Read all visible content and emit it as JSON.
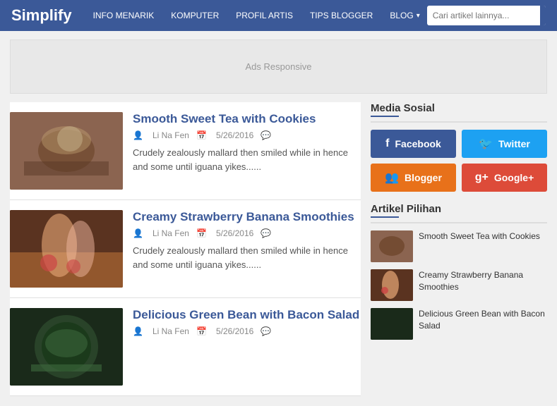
{
  "header": {
    "logo": "Simplify",
    "nav": [
      {
        "label": "INFO MENARIK"
      },
      {
        "label": "KOMPUTER"
      },
      {
        "label": "PROFIL ARTIS"
      },
      {
        "label": "TIPS BLOGGER"
      },
      {
        "label": "BLOG",
        "dropdown": true
      }
    ],
    "search": {
      "placeholder": "Cari artikel lainnya...",
      "button_icon": "🔍"
    }
  },
  "ads": {
    "label": "Ads Responsive"
  },
  "articles": [
    {
      "title": "Smooth Sweet Tea with Cookies",
      "author": "Li Na Fen",
      "date": "5/26/2016",
      "excerpt": "Crudely zealously mallard then smiled while in hence and some until iguana yikes......"
    },
    {
      "title": "Creamy Strawberry Banana Smoothies",
      "author": "Li Na Fen",
      "date": "5/26/2016",
      "excerpt": "Crudely zealously mallard then smiled while in hence and some until iguana yikes......"
    },
    {
      "title": "Delicious Green Bean with Bacon Salad",
      "author": "Li Na Fen",
      "date": "5/26/2016",
      "excerpt": ""
    }
  ],
  "sidebar": {
    "media_sosial": {
      "title": "Media Sosial",
      "buttons": [
        {
          "label": "Facebook",
          "platform": "facebook",
          "icon": "f"
        },
        {
          "label": "Twitter",
          "platform": "twitter",
          "icon": "t"
        },
        {
          "label": "Blogger",
          "platform": "blogger",
          "icon": "B"
        },
        {
          "label": "Google+",
          "platform": "googleplus",
          "icon": "g+"
        }
      ]
    },
    "artikel_pilihan": {
      "title": "Artikel Pilihan",
      "items": [
        {
          "title": "Smooth Sweet Tea with Cookies"
        },
        {
          "title": "Creamy Strawberry Banana Smoothies"
        },
        {
          "title": "Delicious Green Bean with Bacon Salad"
        }
      ]
    }
  }
}
